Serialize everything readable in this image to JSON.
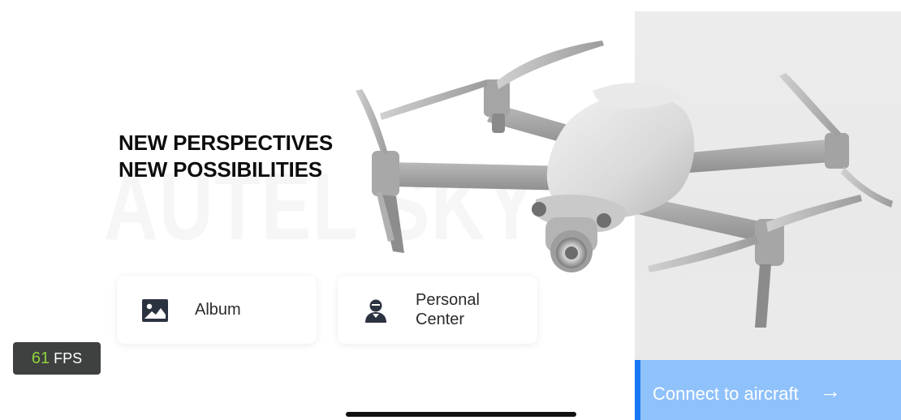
{
  "hero": {
    "watermark_text": "AUTEL SKY",
    "headline_line1": "NEW PERSPECTIVES",
    "headline_line2": "NEW POSSIBILITIES"
  },
  "cards": {
    "album": {
      "label": "Album",
      "icon": "image-icon"
    },
    "personal": {
      "label": "Personal\nCenter",
      "icon": "person-icon"
    }
  },
  "connect": {
    "label": "Connect to aircraft",
    "arrow": "→",
    "accent": "#1577f5",
    "background": "#8fc1fb"
  },
  "fps": {
    "value": "61",
    "unit": "FPS",
    "value_color": "#8ed23b"
  }
}
